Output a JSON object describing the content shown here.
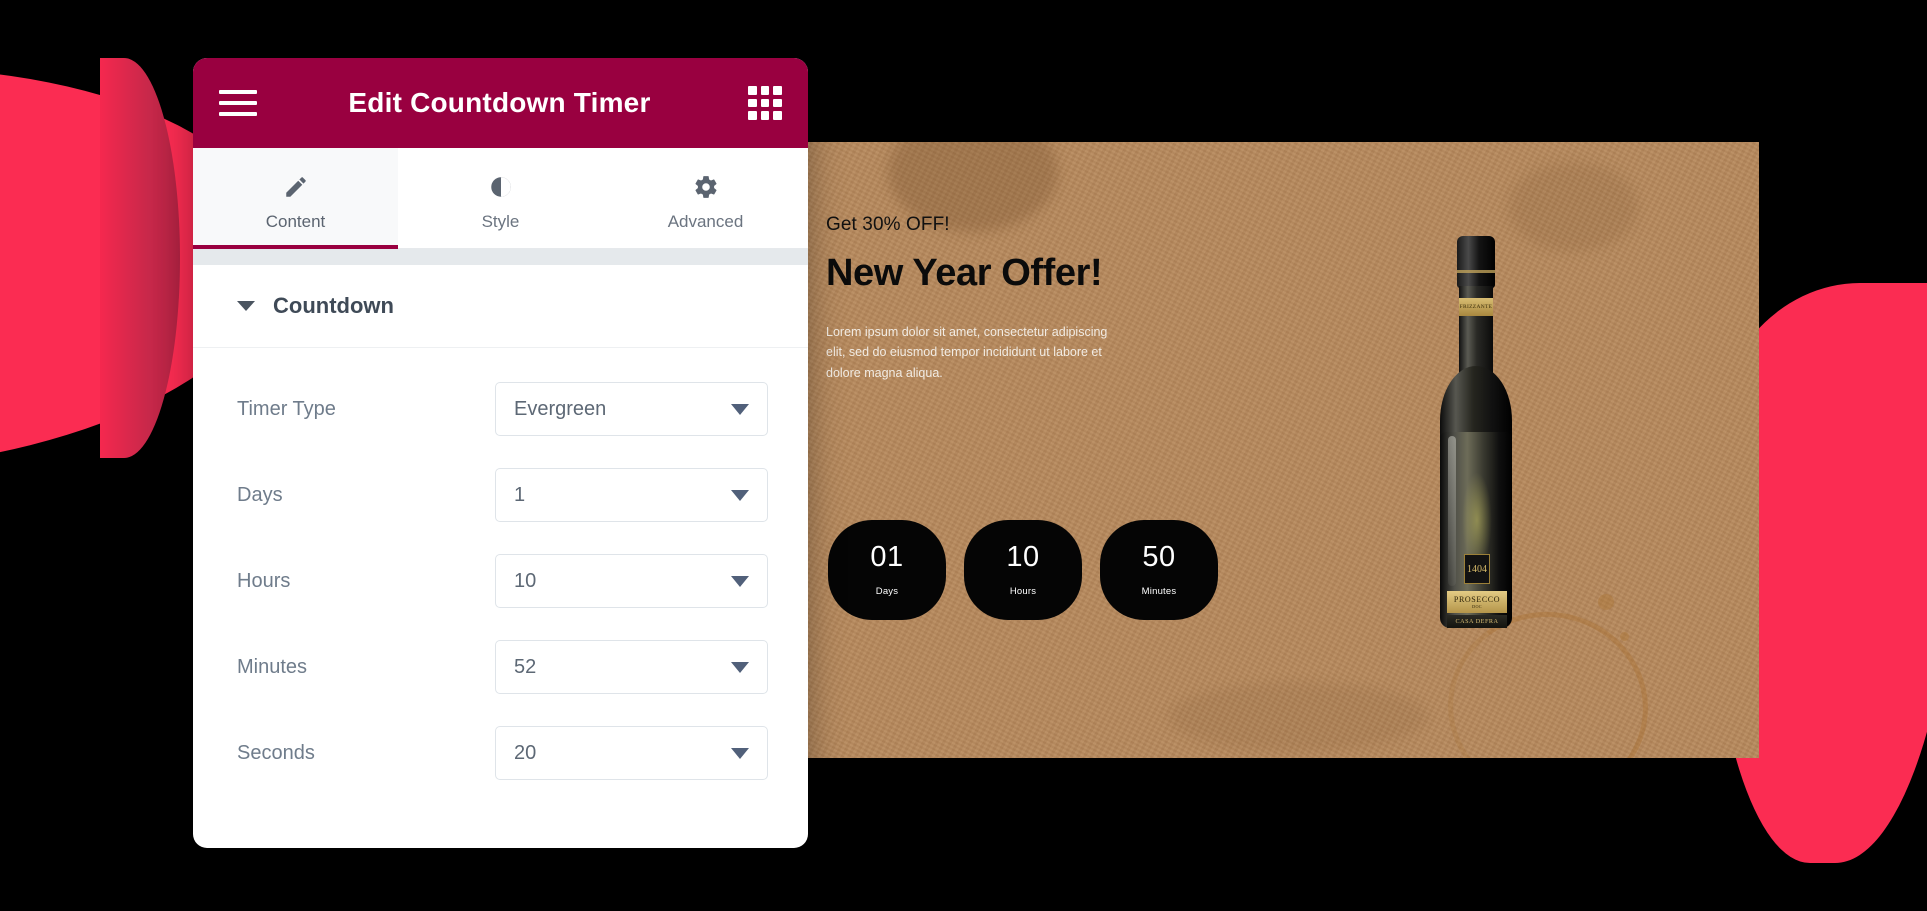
{
  "theme": {
    "header_bg": "#990040",
    "accent_pink": "#fb2c52",
    "page_bg": "#000000",
    "panel_bg": "#ffffff",
    "label_color": "#6f7c8b"
  },
  "panel": {
    "title": "Edit Countdown Timer",
    "menu_icon": "hamburger-icon",
    "apps_icon": "grid-icon",
    "tabs": [
      {
        "label": "Content",
        "icon": "pencil-icon",
        "active": true
      },
      {
        "label": "Style",
        "icon": "contrast-icon",
        "active": false
      },
      {
        "label": "Advanced",
        "icon": "gear-icon",
        "active": false
      }
    ],
    "section": {
      "title": "Countdown",
      "expanded": true,
      "caret_icon": "chevron-down-icon"
    },
    "fields": [
      {
        "label": "Timer Type",
        "value": "Evergreen",
        "caret_icon": "chevron-down-icon"
      },
      {
        "label": "Days",
        "value": "1",
        "caret_icon": "chevron-down-icon"
      },
      {
        "label": "Hours",
        "value": "10",
        "caret_icon": "chevron-down-icon"
      },
      {
        "label": "Minutes",
        "value": "52",
        "caret_icon": "chevron-down-icon"
      },
      {
        "label": "Seconds",
        "value": "20",
        "caret_icon": "chevron-down-icon"
      }
    ]
  },
  "preview": {
    "kicker": "Get 30% OFF!",
    "title": "New Year Offer!",
    "body": "Lorem ipsum dolor sit amet, consectetur adipiscing elit, sed do eiusmod tempor incididunt ut labore et dolore magna aliqua.",
    "timer": [
      {
        "value": "01",
        "label": "Days"
      },
      {
        "value": "10",
        "label": "Hours"
      },
      {
        "value": "50",
        "label": "Minutes"
      }
    ],
    "product": {
      "neck_band": "FRIZZANTE",
      "vintage_badge": "1404",
      "label_name": "PROSECCO",
      "label_sub": "DOC",
      "brand": "CASA DEFRA"
    }
  }
}
